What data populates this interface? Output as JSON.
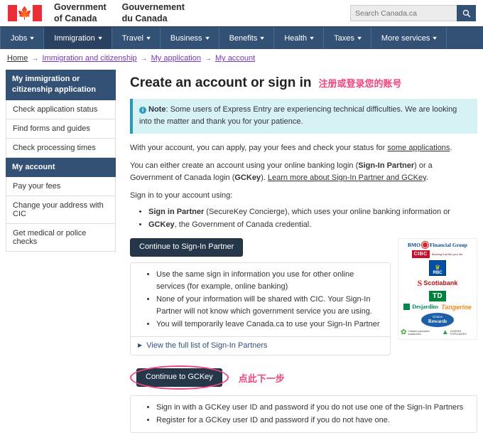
{
  "header": {
    "wordmark_en": "Government\nof Canada",
    "wordmark_en_line1": "Government",
    "wordmark_en_line2": "of Canada",
    "wordmark_fr_line1": "Gouvernement",
    "wordmark_fr_line2": "du Canada",
    "flag_icon": "canada-flag-icon",
    "search": {
      "placeholder": "Search Canada.ca",
      "value": "",
      "button_icon": "search-icon"
    }
  },
  "nav": {
    "items": [
      {
        "label": "Jobs",
        "active": false
      },
      {
        "label": "Immigration",
        "active": true
      },
      {
        "label": "Travel",
        "active": false
      },
      {
        "label": "Business",
        "active": false
      },
      {
        "label": "Benefits",
        "active": false
      },
      {
        "label": "Health",
        "active": false
      },
      {
        "label": "Taxes",
        "active": false
      },
      {
        "label": "More services",
        "active": false
      }
    ],
    "caret_icon": "chevron-down-icon",
    "bar_color": "#335075",
    "active_color": "#2B4162"
  },
  "breadcrumb": {
    "items": [
      {
        "label": "Home",
        "visited": false
      },
      {
        "label": "Immigration and citizenship",
        "visited": true
      },
      {
        "label": "My application",
        "visited": true
      },
      {
        "label": "My account",
        "visited": true
      }
    ],
    "separator": "→",
    "link_color": "#7834BC"
  },
  "sidebar": {
    "sections": [
      {
        "heading": "My immigration or citizenship application",
        "items": [
          "Check application status",
          "Find forms and guides",
          "Check processing times"
        ]
      },
      {
        "heading": "My account",
        "items": [
          "Pay your fees",
          "Change your address with CIC",
          "Get medical or police checks"
        ]
      }
    ]
  },
  "main": {
    "title": "Create an account or sign in",
    "title_annotation": "注册或登录您的账号",
    "annotation_color": "#F2457F",
    "note": {
      "icon": "info-circle-icon",
      "label": "Note",
      "text": ": Some users of Express Entry are experiencing technical difficulties. We are looking into the matter and thank you for your patience."
    },
    "paragraph1_pre": "With your account, you can apply, pay your fees and check your status for ",
    "paragraph1_link": "some applications",
    "paragraph1_post": ".",
    "paragraph2_pre": "You can either create an account using your online banking login (",
    "paragraph2_bold1": "Sign-In Partner",
    "paragraph2_mid": ") or a Government of Canada login (",
    "paragraph2_bold2": "GCKey",
    "paragraph2_post": "). ",
    "paragraph2_link": "Learn more about Sign-In Partner and GCKey",
    "paragraph2_end": ".",
    "paragraph3": "Sign in to your account using:",
    "signin_options": [
      {
        "bold": "Sign in Partner",
        "text": " (SecureKey Concierge), which uses your online banking information or"
      },
      {
        "bold": "GCKey",
        "text": ", the Government of Canada credential."
      }
    ],
    "partner": {
      "button_label": "Continue to Sign-In Partner",
      "bullets": [
        "Use the same sign in information you use for other online services (for example, online banking)",
        "None of your information will be shared with CIC. Your Sign-In Partner will not know which government service you are using.",
        "You will temporarily leave Canada.ca to use your Sign-In Partner"
      ],
      "expander_label": "View the full list of Sign-In Partners",
      "expander_icon": "triangle-right-icon"
    },
    "bank_logos": [
      {
        "name": "bmo-logo",
        "text": "BMO",
        "suffix": "Financial Group"
      },
      {
        "name": "cibc-logo",
        "text": "CIBC",
        "tagline": "Banking that fits your life."
      },
      {
        "name": "rbc-logo",
        "text": "RBC"
      },
      {
        "name": "scotiabank-logo",
        "text": "Scotiabank"
      },
      {
        "name": "td-logo",
        "text": "TD"
      },
      {
        "name": "desjardins-logo",
        "text": "Desjardins"
      },
      {
        "name": "tangerine-logo",
        "text": "Tangerine"
      },
      {
        "name": "choice-rewards-logo",
        "text": "Choice",
        "text2": "Rewards"
      },
      {
        "name": "caisses-populaires-acadiennes-logo",
        "text": "Caisses populaires acadiennes"
      },
      {
        "name": "canada-populaires-logo",
        "text": "CAISSES POPULAIRES"
      }
    ],
    "gckey": {
      "button_label": "Continue to GCKey",
      "annotation": "点此下一步",
      "bullets": [
        "Sign in with a GCKey user ID and password if you do not use one of the Sign-In Partners",
        "Register for a GCKey user ID and password if you do not have one."
      ]
    }
  }
}
